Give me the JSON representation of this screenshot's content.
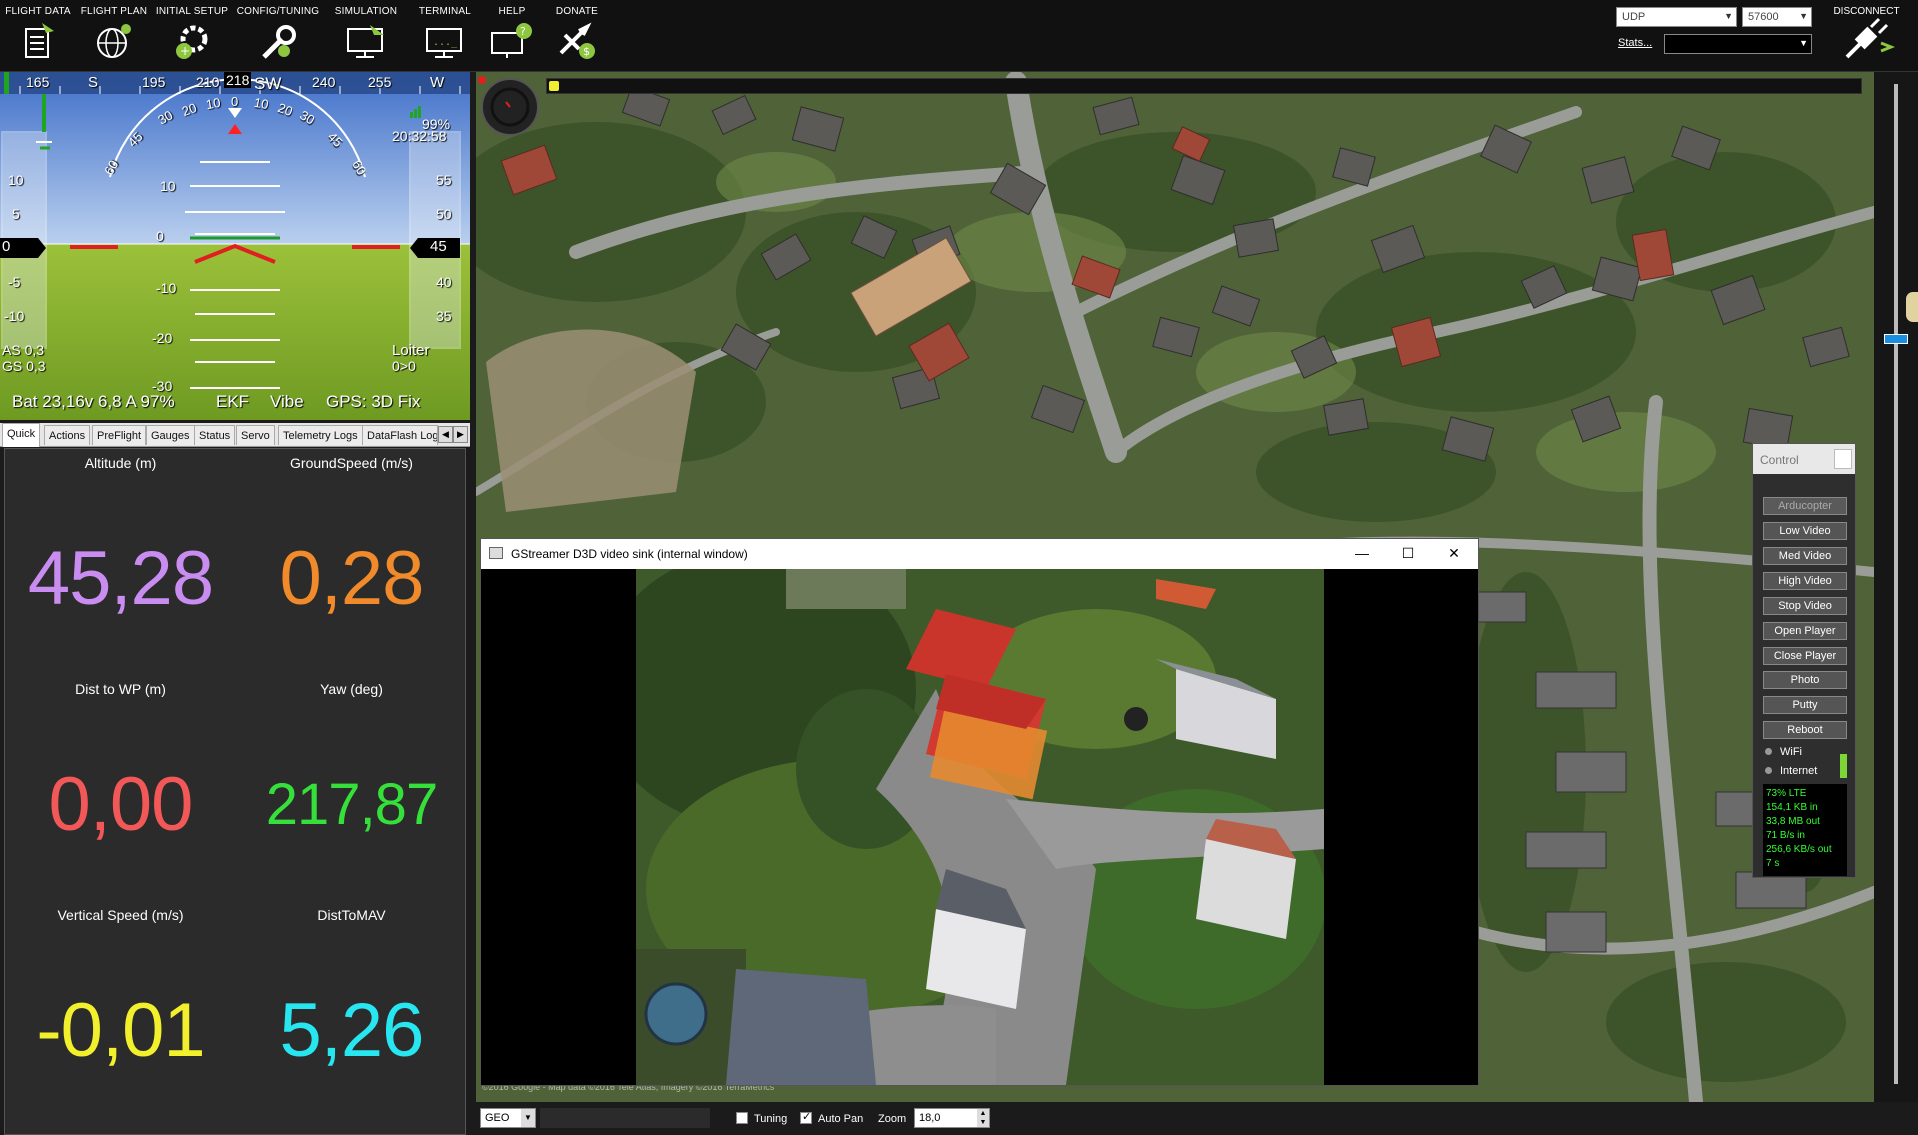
{
  "toolbar": {
    "menu": [
      {
        "label": "FLIGHT DATA",
        "icon": "flight-data-icon"
      },
      {
        "label": "FLIGHT PLAN",
        "icon": "flight-plan-icon"
      },
      {
        "label": "INITIAL SETUP",
        "icon": "initial-setup-icon"
      },
      {
        "label": "CONFIG/TUNING",
        "icon": "config-tuning-icon"
      },
      {
        "label": "SIMULATION",
        "icon": "simulation-icon"
      },
      {
        "label": "TERMINAL",
        "icon": "terminal-icon"
      },
      {
        "label": "HELP",
        "icon": "help-icon"
      },
      {
        "label": "DONATE",
        "icon": "donate-icon"
      }
    ],
    "connection_type": "UDP",
    "baud_rate": "57600",
    "stats_label": "Stats...",
    "disconnect_label": "DISCONNECT"
  },
  "hud": {
    "heading_ticks": [
      "165",
      "S",
      "195",
      "210",
      "SW",
      "240",
      "255",
      "W"
    ],
    "heading_value": "218",
    "roll_ticks": [
      "60",
      "45",
      "30",
      "20",
      "10",
      "0",
      "10",
      "20",
      "30",
      "45",
      "60"
    ],
    "pitch_ticks": [
      "10",
      "0",
      "-10",
      "-20",
      "-30"
    ],
    "speed_ticks": [
      "10",
      "5",
      "0",
      "-5",
      "-10"
    ],
    "alt_ticks": [
      "55",
      "50",
      "45",
      "40",
      "35"
    ],
    "speed_value": "0",
    "alt_value": "45",
    "link_quality": "99%",
    "time": "20:32:58",
    "airspeed": "AS 0,3",
    "groundspeed": "GS 0,3",
    "mode": "Loiter",
    "wp": "0>0",
    "battery": "Bat 23,16v 6,8 A 97%",
    "ekf": "EKF",
    "vibe": "Vibe",
    "gps": "GPS: 3D Fix"
  },
  "tabs": [
    "Quick",
    "Actions",
    "PreFlight",
    "Gauges",
    "Status",
    "Servo",
    "Telemetry Logs",
    "DataFlash Logs"
  ],
  "quick": [
    {
      "label": "Altitude (m)",
      "value": "45,28",
      "color": "#c98cf0"
    },
    {
      "label": "GroundSpeed (m/s)",
      "value": "0,28",
      "color": "#f08a2a"
    },
    {
      "label": "Dist to WP (m)",
      "value": "0,00",
      "color": "#f25858"
    },
    {
      "label": "Yaw (deg)",
      "value": "217,87",
      "color": "#36e03a"
    },
    {
      "label": "Vertical Speed (m/s)",
      "value": "-0,01",
      "color": "#f2ef2c"
    },
    {
      "label": "DistToMAV",
      "value": "5,26",
      "color": "#28e6f0"
    }
  ],
  "video_window": {
    "title": "GStreamer D3D video sink (internal window)",
    "minimize": "—",
    "maximize": "☐",
    "close": "✕"
  },
  "control": {
    "title": "Control",
    "buttons": [
      "Arducopter",
      "Low Video",
      "Med Video",
      "High Video",
      "Stop Video",
      "Open Player",
      "Close Player",
      "Photo",
      "Putty",
      "Reboot"
    ],
    "wifi_label": "WiFi",
    "internet_label": "Internet",
    "net_stats": [
      "73% LTE",
      "154,1 KB in",
      "33,8 MB out",
      "71 B/s in",
      "256,6 KB/s out",
      "7 s"
    ]
  },
  "bottom": {
    "coord_type": "GEO",
    "tuning_label": "Tuning",
    "tuning_checked": false,
    "autopan_label": "Auto Pan",
    "autopan_checked": true,
    "zoom_label": "Zoom",
    "zoom_value": "18,0"
  },
  "map": {
    "copyright": "©2016 Google - Map data ©2016 Tele Atlas, Imagery ©2016 TerraMetrics"
  },
  "colors": {
    "sky": "#6b94d6",
    "ground": "#7faa2a",
    "accent": "#1a8fe0"
  }
}
